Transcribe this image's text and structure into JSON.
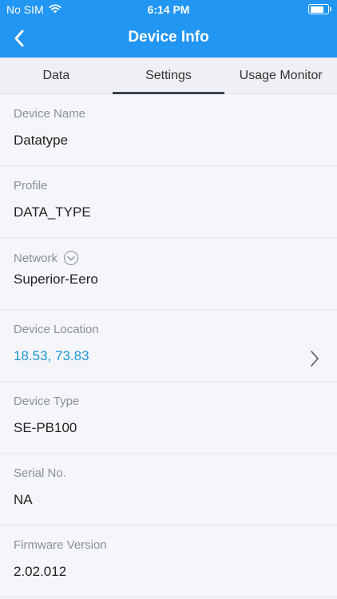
{
  "status_bar": {
    "carrier": "No SIM",
    "time": "6:14 PM"
  },
  "nav": {
    "title": "Device Info",
    "back_icon": "chevron-left-icon"
  },
  "tabs": [
    {
      "label": "Data",
      "active": false
    },
    {
      "label": "Settings",
      "active": true
    },
    {
      "label": "Usage Monitor",
      "active": false
    }
  ],
  "fields": {
    "device_name": {
      "label": "Device Name",
      "value": "Datatype"
    },
    "profile": {
      "label": "Profile",
      "value": "DATA_TYPE"
    },
    "network": {
      "label": "Network",
      "value": "Superior-Eero"
    },
    "device_location": {
      "label": "Device Location",
      "value": "18.53, 73.83"
    },
    "device_type": {
      "label": "Device Type",
      "value": "SE-PB100"
    },
    "serial_no": {
      "label": "Serial No.",
      "value": "NA"
    },
    "firmware_version": {
      "label": "Firmware Version",
      "value": "2.02.012"
    }
  },
  "colors": {
    "header_blue": "#2196f3",
    "link_blue": "#1e96d8",
    "label_gray": "#8a8f99",
    "background": "#f5f6fa"
  }
}
